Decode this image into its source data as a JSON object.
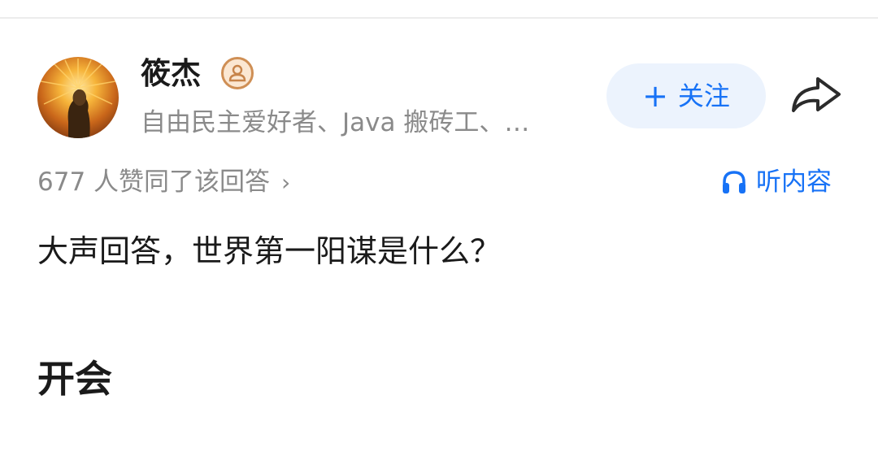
{
  "author": {
    "name": "筱杰",
    "bio": "自由民主爱好者、Java 搬砖工、…"
  },
  "actions": {
    "follow_plus": "+",
    "follow_label": "关注"
  },
  "meta": {
    "votes_text": "677 人赞同了该回答",
    "votes_chevron": "›",
    "listen_label": "听内容"
  },
  "question": "大声回答，世界第一阳谋是什么？",
  "answer_text": "开会",
  "colors": {
    "accent": "#1772f6",
    "follow_bg": "#ecf3fd",
    "muted_text": "#8a8a8a",
    "badge": "#cf8f55"
  },
  "icons": [
    "avatar-image",
    "user-badge-icon",
    "share-icon",
    "headphones-icon",
    "chevron-right-icon"
  ]
}
